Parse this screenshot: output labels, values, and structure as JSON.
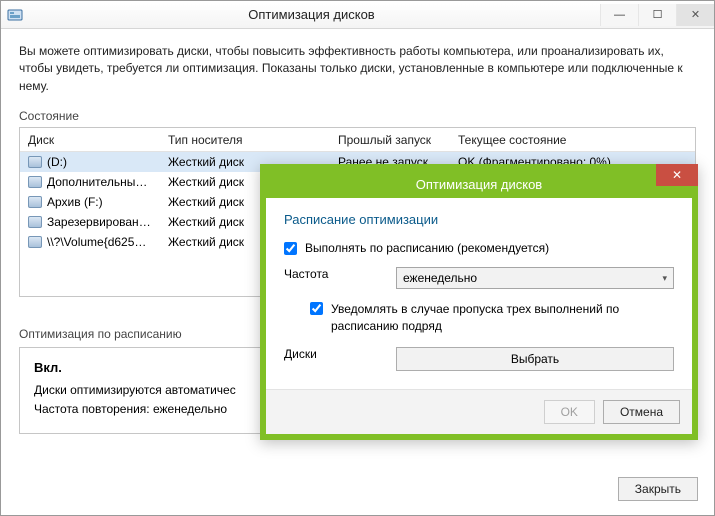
{
  "window": {
    "title": "Оптимизация дисков",
    "description": "Вы можете оптимизировать диски, чтобы повысить эффективность работы  компьютера, или проанализировать их, чтобы увидеть, требуется ли оптимизация. Показаны только диски, установленные в компьютере или подключенные к нему.",
    "state_label": "Состояние",
    "columns": {
      "disk": "Диск",
      "media": "Тип носителя",
      "last": "Прошлый запуск",
      "status": "Текущее состояние"
    },
    "rows": [
      {
        "name": "(D:)",
        "media": "Жесткий диск",
        "last": "Ранее не запуска...",
        "status": "OK (Фрагментировано: 0%)",
        "selected": true
      },
      {
        "name": "Дополнительный ...",
        "media": "Жесткий диск",
        "last": "",
        "status": "",
        "selected": false
      },
      {
        "name": "Архив (F:)",
        "media": "Жесткий диск",
        "last": "",
        "status": "",
        "selected": false
      },
      {
        "name": "Зарезервировано ...",
        "media": "Жесткий диск",
        "last": "",
        "status": "",
        "selected": false
      },
      {
        "name": "\\\\?\\Volume{d625df...",
        "media": "Жесткий диск",
        "last": "",
        "status": "",
        "selected": false
      }
    ],
    "schedule_section_label": "Оптимизация по расписанию",
    "schedule_on": "Вкл.",
    "schedule_line1": "Диски оптимизируются автоматичес",
    "schedule_line2": "Частота повторения: еженедельно",
    "close_button": "Закрыть"
  },
  "modal": {
    "title": "Оптимизация дисков",
    "heading": "Расписание оптимизации",
    "run_checkbox": "Выполнять по расписанию (рекомендуется)",
    "frequency_label": "Частота",
    "frequency_value": "еженедельно",
    "notify_checkbox": "Уведомлять в случае пропуска трех выполнений по расписанию подряд",
    "disks_label": "Диски",
    "choose_button": "Выбрать",
    "ok_button": "OK",
    "cancel_button": "Отмена"
  }
}
